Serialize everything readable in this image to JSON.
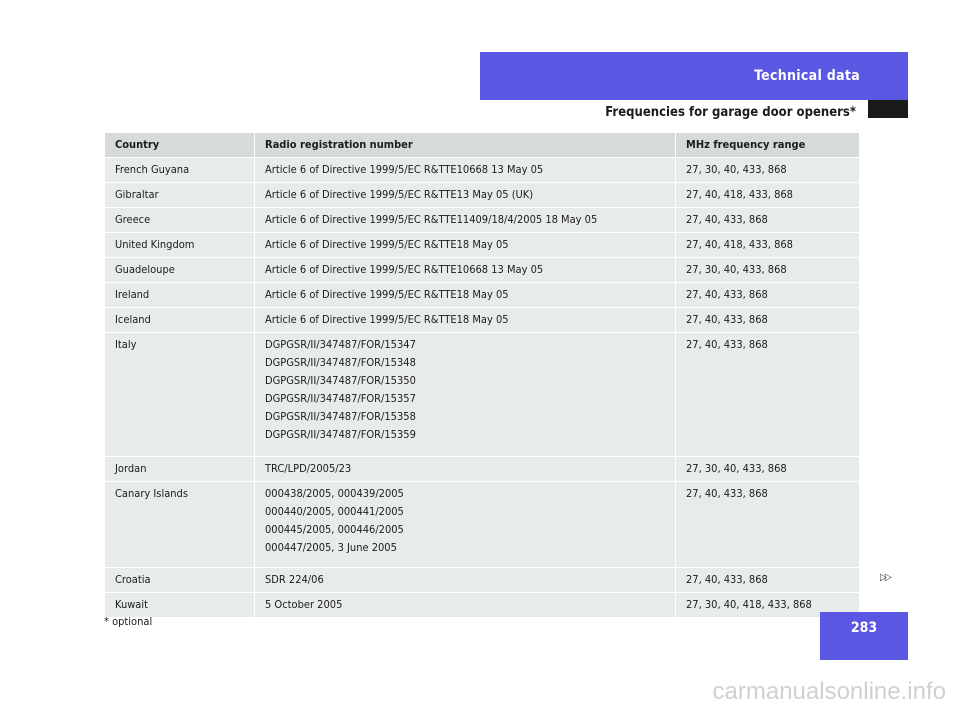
{
  "header": {
    "section": "Technical data",
    "subtitle": "Frequencies for garage door openers*"
  },
  "table": {
    "columns": [
      "Country",
      "Radio registration number",
      "MHz frequency range"
    ],
    "rows": [
      {
        "country": "French Guyana",
        "registration": [
          "Article 6 of Directive 1999/5/EC R&TTE10668 13 May 05"
        ],
        "frequency": "27, 30, 40, 433, 868"
      },
      {
        "country": "Gibraltar",
        "registration": [
          "Article 6 of Directive 1999/5/EC R&TTE13 May 05 (UK)"
        ],
        "frequency": "27, 40, 418, 433, 868"
      },
      {
        "country": "Greece",
        "registration": [
          "Article 6 of Directive 1999/5/EC R&TTE11409/18/4/2005 18 May 05"
        ],
        "frequency": "27, 40, 433, 868"
      },
      {
        "country": "United Kingdom",
        "registration": [
          "Article 6 of Directive 1999/5/EC R&TTE18 May 05"
        ],
        "frequency": "27, 40, 418, 433, 868"
      },
      {
        "country": "Guadeloupe",
        "registration": [
          "Article 6 of Directive 1999/5/EC R&TTE10668 13 May 05"
        ],
        "frequency": "27, 30, 40, 433, 868"
      },
      {
        "country": "Ireland",
        "registration": [
          "Article 6 of Directive 1999/5/EC R&TTE18 May 05"
        ],
        "frequency": "27, 40, 433, 868"
      },
      {
        "country": "Iceland",
        "registration": [
          "Article 6 of Directive 1999/5/EC R&TTE18 May 05"
        ],
        "frequency": "27, 40, 433, 868"
      },
      {
        "country": "Italy",
        "registration": [
          "DGPGSR/II/347487/FOR/15347",
          "DGPGSR/II/347487/FOR/15348",
          "DGPGSR/II/347487/FOR/15350",
          "DGPGSR/II/347487/FOR/15357",
          "DGPGSR/II/347487/FOR/15358",
          "DGPGSR/II/347487/FOR/15359"
        ],
        "frequency": "27, 40, 433, 868"
      },
      {
        "country": "Jordan",
        "registration": [
          "TRC/LPD/2005/23"
        ],
        "frequency": "27, 30, 40, 433, 868"
      },
      {
        "country": "Canary Islands",
        "registration": [
          "000438/2005, 000439/2005",
          "000440/2005, 000441/2005",
          "000445/2005, 000446/2005",
          "000447/2005, 3 June 2005"
        ],
        "frequency": "27, 40, 433, 868"
      },
      {
        "country": "Croatia",
        "registration": [
          "SDR 224/06"
        ],
        "frequency": "27, 40, 433, 868"
      },
      {
        "country": "Kuwait",
        "registration": [
          "5 October 2005"
        ],
        "frequency": "27, 30, 40, 418, 433, 868"
      }
    ]
  },
  "footnote": "* optional",
  "page_number": "283",
  "next_icon": "double-arrow-right-icon",
  "watermark": "carmanualsonline.info",
  "colors": {
    "accent": "#5a57e3",
    "header_cell": "#d7dadb",
    "body_cell": "#e8ebec"
  }
}
